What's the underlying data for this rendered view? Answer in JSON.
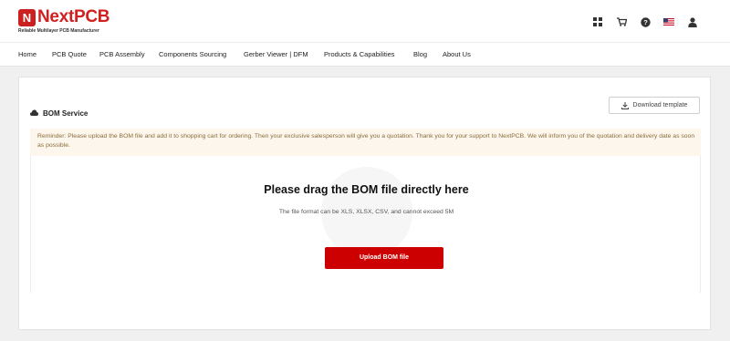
{
  "brand": {
    "logo_mark": "N",
    "name": "NextPCB",
    "tagline": "Reliable Multilayer PCB Manufacturer",
    "accent": "#cc1f1f"
  },
  "header_icons": [
    "grid-icon",
    "cart-icon",
    "help-icon",
    "us-flag-icon",
    "user-icon"
  ],
  "nav": {
    "items": [
      {
        "label": "Home"
      },
      {
        "label": "PCB Quote"
      },
      {
        "label": "PCB Assembly"
      },
      {
        "label": "Components Sourcing"
      },
      {
        "label": "Gerber Viewer | DFM"
      },
      {
        "label": "Products & Capabilities"
      },
      {
        "label": "Blog"
      },
      {
        "label": "About Us"
      }
    ]
  },
  "bom": {
    "title": "BOM Service",
    "download_label": "Download template",
    "notice": "Reminder: Please upload the BOM file and add it to shopping cart for ordering. Then your exclusive salesperson will give you a quotation. Thank you for your support to NextPCB. We will inform you of the quotation and delivery date as soon as possible.",
    "drop_title": "Please drag the BOM file directly here",
    "drop_subtitle": "The file format can be XLS, XLSX, CSV, and cannot exceed 5M",
    "upload_label": "Upload BOM file",
    "upload_color": "#cc0000"
  }
}
